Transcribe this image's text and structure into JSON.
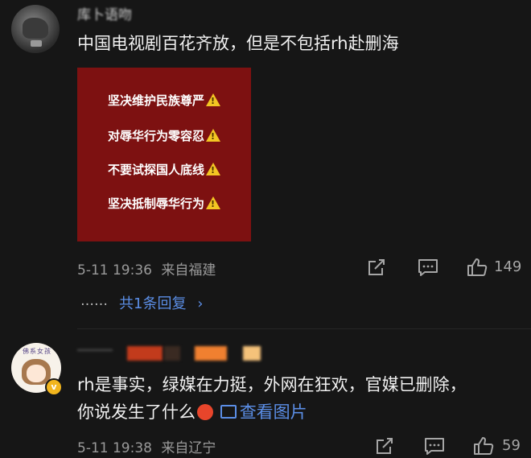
{
  "comment1": {
    "username": "库卜语吻",
    "text": "中国电视剧百花齐放，但是不包括rh赴删海",
    "image_card": {
      "lines": [
        "坚决维护民族尊严",
        "对辱华行为零容忍",
        "不要试探国人底线",
        "坚决抵制辱华行为"
      ],
      "warning_icon": "warning-triangle-icon",
      "background": "#7d1111"
    },
    "date_time": "5-11 19:36",
    "location": "来自福建",
    "like_count": "149",
    "reply_prefix": "……",
    "reply_text": "共1条回复",
    "reply_chevron": "›"
  },
  "comment2": {
    "text_line1": "rh是事实，绿媒在力挺，外网在狂欢，官媒已删除，",
    "text_line2": "你说发生了什么",
    "view_image_label": "查看图片",
    "avatar_text": "佛系女孩",
    "badge": "v",
    "date_time": "5-11 19:38",
    "location": "来自辽宁",
    "like_count": "59"
  },
  "colors": {
    "background": "#161616",
    "link": "#5b8ee6",
    "meta": "#9a9a9a",
    "warning": "#f3c623"
  }
}
